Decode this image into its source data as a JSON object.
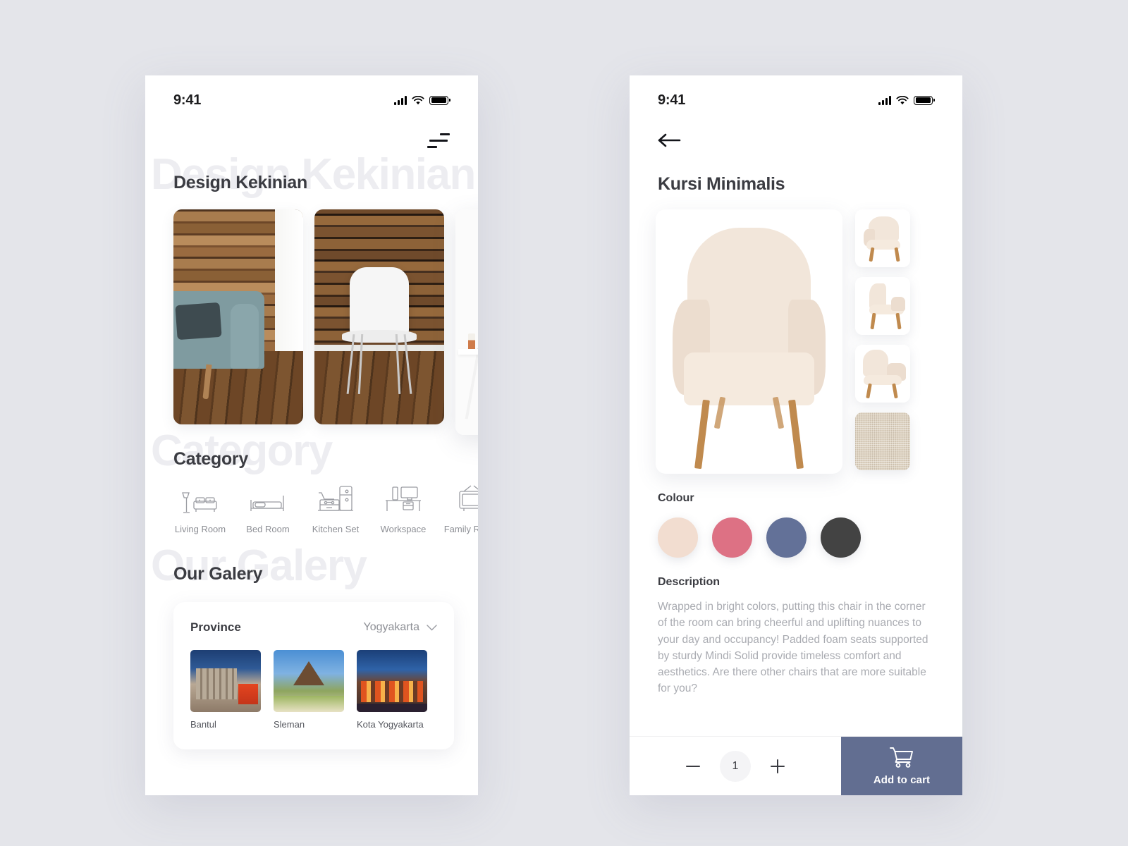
{
  "screens": {
    "home": {
      "status": {
        "time": "9:41",
        "signal_icon": "signal-bars-icon",
        "wifi_icon": "wifi-icon",
        "battery_icon": "battery-icon"
      },
      "menu_icon": "hamburger-menu-icon",
      "sections": {
        "featured": {
          "title": "Design Kekinian",
          "ghost": "Design Kekinian",
          "cards": [
            {
              "name": "teal-sofa-wood-wall"
            },
            {
              "name": "white-chair-wood-wall"
            },
            {
              "name": "white-workspace-desk"
            }
          ]
        },
        "category": {
          "title": "Category",
          "ghost": "Category",
          "items": [
            {
              "label": "Living Room",
              "icon": "sofa-lamp-icon"
            },
            {
              "label": "Bed Room",
              "icon": "bed-icon"
            },
            {
              "label": "Kitchen Set",
              "icon": "kitchen-fridge-icon"
            },
            {
              "label": "Workspace",
              "icon": "desk-monitor-icon"
            },
            {
              "label": "Family Room",
              "icon": "television-icon"
            }
          ]
        },
        "gallery": {
          "title": "Our Galery",
          "ghost": "Our Galery",
          "province_label": "Province",
          "province_value": "Yogyakarta",
          "chevron_icon": "chevron-down-icon",
          "items": [
            {
              "name": "Bantul"
            },
            {
              "name": "Sleman"
            },
            {
              "name": "Kota Yogyakarta"
            }
          ]
        }
      }
    },
    "detail": {
      "status": {
        "time": "9:41",
        "signal_icon": "signal-bars-icon",
        "wifi_icon": "wifi-icon",
        "battery_icon": "battery-icon"
      },
      "back_icon": "arrow-left-icon",
      "title": "Kursi Minimalis",
      "main_image": "armchair-front-view",
      "thumbnails": [
        {
          "name": "armchair-three-quarter-view"
        },
        {
          "name": "armchair-side-view"
        },
        {
          "name": "armchair-angled-view"
        },
        {
          "name": "fabric-swatch"
        }
      ],
      "colour": {
        "label": "Colour",
        "options": [
          {
            "name": "cream",
            "hex": "#f2ddd0"
          },
          {
            "name": "rose",
            "hex": "#dd7184"
          },
          {
            "name": "slate-blue",
            "hex": "#637198"
          },
          {
            "name": "charcoal",
            "hex": "#434343"
          }
        ]
      },
      "description": {
        "label": "Description",
        "text": "Wrapped in bright colors, putting this chair in the corner of the room can bring cheerful and uplifting nuances to your day and occupancy! Padded foam seats supported by sturdy Mindi Solid provide timeless comfort and aesthetics. Are there other chairs that are more suitable for you?"
      },
      "cart": {
        "minus_label": "−",
        "plus_label": "+",
        "quantity": "1",
        "cart_icon": "shopping-cart-icon",
        "button_label": "Add to cart",
        "button_color": "#626e91"
      }
    }
  },
  "theme": {
    "page_background": "#e4e5ea",
    "surface": "#ffffff",
    "text_primary": "#3b3c42",
    "text_muted": "#8d8f95",
    "ghost_text": "#ededf1"
  }
}
